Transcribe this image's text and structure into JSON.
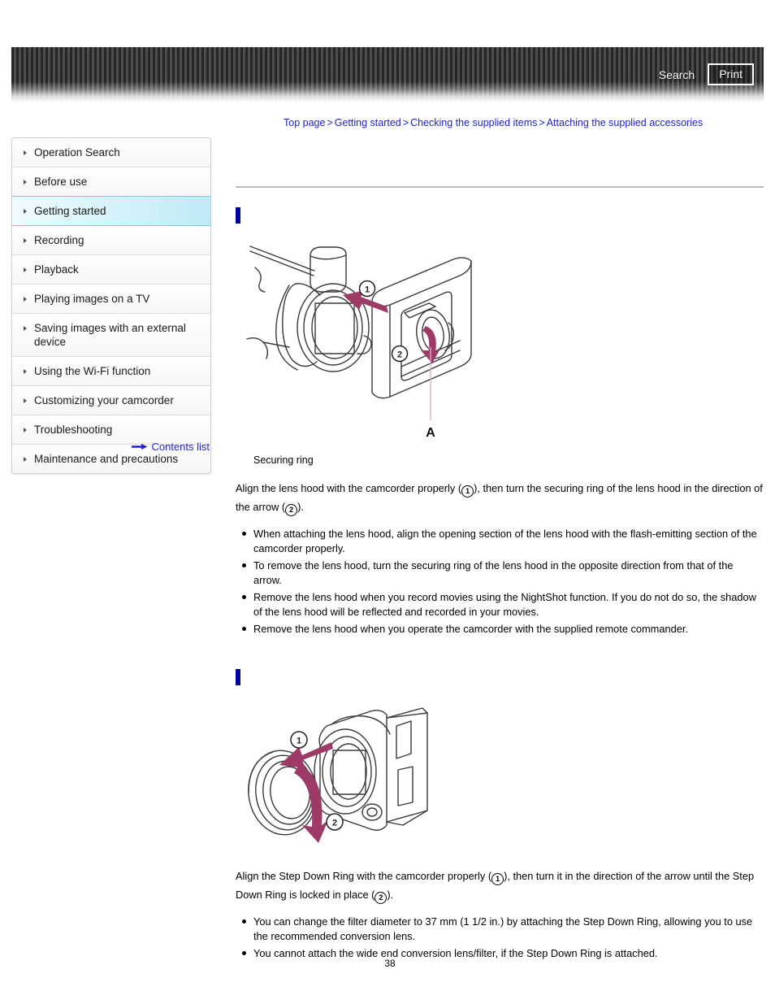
{
  "header": {
    "search_label": "Search",
    "print_label": "Print",
    "search_icon": "search-icon",
    "print_icon": "printer-icon"
  },
  "breadcrumb": {
    "separator": ">",
    "items": [
      "Top page",
      "Getting started",
      "Checking the supplied items",
      "Attaching the supplied accessories"
    ]
  },
  "sidebar": {
    "items": [
      {
        "label": "Operation Search",
        "active": false
      },
      {
        "label": "Before use",
        "active": false
      },
      {
        "label": "Getting started",
        "active": true
      },
      {
        "label": "Recording",
        "active": false
      },
      {
        "label": "Playback",
        "active": false
      },
      {
        "label": "Playing images on a TV",
        "active": false
      },
      {
        "label": "Saving images with an external device",
        "active": false
      },
      {
        "label": "Using the Wi-Fi function",
        "active": false
      },
      {
        "label": "Customizing your camcorder",
        "active": false
      },
      {
        "label": "Troubleshooting",
        "active": false
      },
      {
        "label": "Maintenance and precautions",
        "active": false
      }
    ],
    "contents_list_label": "Contents list",
    "contents_list_icon": "arrow-right-icon"
  },
  "main": {
    "section1": {
      "heading": "",
      "figure_alt": "lens-hood-attachment-diagram",
      "figure_labels": {
        "step1": "1",
        "step2": "2",
        "part": "A"
      },
      "figure_caption": "Securing ring",
      "paragraph_pre": "Align the lens hood with the camcorder properly (",
      "paragraph_mid": "), then turn the securing ring of the lens hood in the direction of the arrow (",
      "paragraph_post": ").",
      "step1": "1",
      "step2": "2",
      "notes": [
        "When attaching the lens hood, align the opening section of the lens hood with the flash-emitting section of the camcorder properly.",
        "To remove the lens hood, turn the securing ring of the lens hood in the opposite direction from that of the arrow.",
        "Remove the lens hood when you record movies using the NightShot function. If you do not do so, the shadow of the lens hood will be reflected and recorded in your movies.",
        "Remove the lens hood when you operate the camcorder with the supplied remote commander."
      ]
    },
    "section2": {
      "heading": "",
      "figure_alt": "step-down-ring-attachment-diagram",
      "figure_labels": {
        "step1": "1",
        "step2": "2"
      },
      "paragraph_pre": "Align the Step Down Ring with the camcorder properly (",
      "paragraph_mid": "), then turn it in the direction of the arrow until the Step Down Ring is locked in place (",
      "paragraph_post": ").",
      "step1": "1",
      "step2": "2",
      "notes": [
        "You can change the filter diameter to 37 mm (1 1/2 in.) by attaching the Step Down Ring, allowing you to use the recommended conversion lens.",
        "You cannot attach the wide end conversion lens/filter, if the Step Down Ring is attached."
      ]
    }
  },
  "footer": {
    "page_number": "38"
  },
  "colors": {
    "link": "#2222cc",
    "section_bar": "#00009c",
    "active_nav": "#bfeaf7",
    "header_stripe_dark": "#262626",
    "header_stripe_light": "#4d4d4d",
    "diagram_accent": "#a33a6b"
  }
}
